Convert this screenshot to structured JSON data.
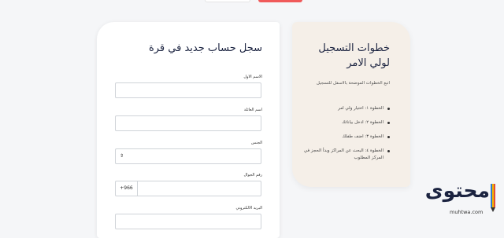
{
  "form": {
    "title": "سجل حساب جديد في قرة",
    "fields": [
      {
        "label": "الاسم الاول"
      },
      {
        "label": "اسم العائلة"
      },
      {
        "label": "الجنس",
        "select_icon": "⇕"
      },
      {
        "label": "رقم الجوال",
        "prefix": "+966"
      },
      {
        "label": "البريد الالكتروني"
      }
    ]
  },
  "steps": {
    "title": "خطوات التسجيل لولي الامر",
    "intro": "اتبع الخطوات الموضحة بالاسفل للتسجيل",
    "items": [
      "الخطوة ١: اختيار ولي امر",
      "الخطوة ٢: ادخل بياناتك",
      "الخطوة ٣: اضف طفلك",
      "الخطوة ٤: البحث عن المراكز وبدأ الحجز في المركز المطلوب"
    ]
  },
  "logo": {
    "text": "محتوى",
    "url": "muhtwa.com"
  },
  "colors": {
    "title": "#1b2340",
    "steps_bg": "#f5efe8",
    "accent_red": "#f05a5a"
  }
}
